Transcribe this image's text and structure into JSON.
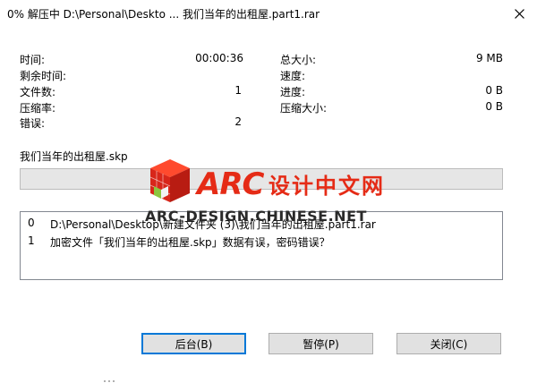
{
  "window": {
    "title": "0% 解压中 D:\\Personal\\Deskto ... 我们当年的出租屋.part1.rar",
    "close_icon": "close-icon"
  },
  "stats_left": [
    {
      "label": "时间:",
      "value": "00:00:36"
    },
    {
      "label": "剩余时间:",
      "value": ""
    },
    {
      "label": "文件数:",
      "value": "1"
    },
    {
      "label": "压缩率:",
      "value": ""
    },
    {
      "label": "错误:",
      "value": "2"
    }
  ],
  "stats_right": [
    {
      "label": "总大小:",
      "value": "9 MB"
    },
    {
      "label": "速度:",
      "value": ""
    },
    {
      "label": "进度:",
      "value": "0 B"
    },
    {
      "label": "压缩大小:",
      "value": "0 B"
    }
  ],
  "current_file": "我们当年的出租屋.skp",
  "progress": {
    "fraction": 0.0,
    "fill_color": "#06b025"
  },
  "log": [
    {
      "index": "0",
      "message": "D:\\Personal\\Desktop\\新建文件夹 (3)\\我们当年的出租屋.part1.rar"
    },
    {
      "index": "1",
      "message": "加密文件「我们当年的出租屋.skp」数据有误，密码错误？"
    }
  ],
  "watermark": {
    "brand": "ARC",
    "chinese": "设计中文网",
    "english": "ARC-DESIGN.CHINESE.NET",
    "color": "#e52b16"
  },
  "buttons": {
    "background": "后台(B)",
    "pause": "暂停(P)",
    "close": "关闭(C)"
  }
}
